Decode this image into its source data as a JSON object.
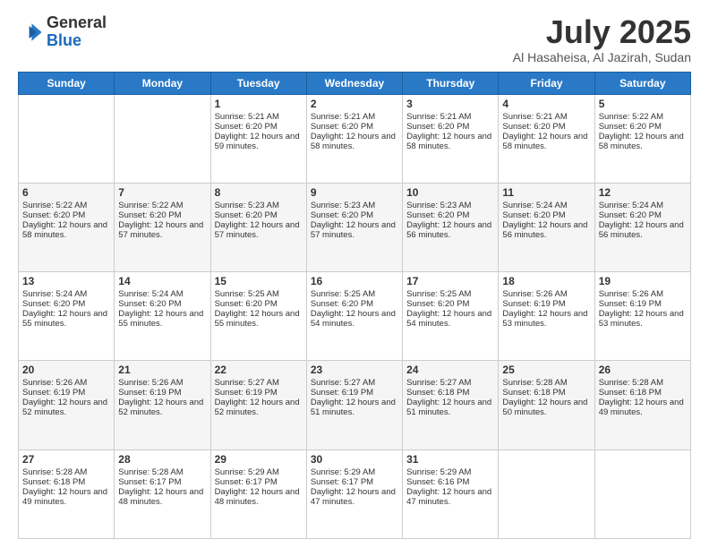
{
  "header": {
    "logo_line1": "General",
    "logo_line2": "Blue",
    "month_year": "July 2025",
    "location": "Al Hasaheisa, Al Jazirah, Sudan"
  },
  "days_of_week": [
    "Sunday",
    "Monday",
    "Tuesday",
    "Wednesday",
    "Thursday",
    "Friday",
    "Saturday"
  ],
  "weeks": [
    [
      {
        "day": "",
        "sunrise": "",
        "sunset": "",
        "daylight": ""
      },
      {
        "day": "",
        "sunrise": "",
        "sunset": "",
        "daylight": ""
      },
      {
        "day": "1",
        "sunrise": "Sunrise: 5:21 AM",
        "sunset": "Sunset: 6:20 PM",
        "daylight": "Daylight: 12 hours and 59 minutes."
      },
      {
        "day": "2",
        "sunrise": "Sunrise: 5:21 AM",
        "sunset": "Sunset: 6:20 PM",
        "daylight": "Daylight: 12 hours and 58 minutes."
      },
      {
        "day": "3",
        "sunrise": "Sunrise: 5:21 AM",
        "sunset": "Sunset: 6:20 PM",
        "daylight": "Daylight: 12 hours and 58 minutes."
      },
      {
        "day": "4",
        "sunrise": "Sunrise: 5:21 AM",
        "sunset": "Sunset: 6:20 PM",
        "daylight": "Daylight: 12 hours and 58 minutes."
      },
      {
        "day": "5",
        "sunrise": "Sunrise: 5:22 AM",
        "sunset": "Sunset: 6:20 PM",
        "daylight": "Daylight: 12 hours and 58 minutes."
      }
    ],
    [
      {
        "day": "6",
        "sunrise": "Sunrise: 5:22 AM",
        "sunset": "Sunset: 6:20 PM",
        "daylight": "Daylight: 12 hours and 58 minutes."
      },
      {
        "day": "7",
        "sunrise": "Sunrise: 5:22 AM",
        "sunset": "Sunset: 6:20 PM",
        "daylight": "Daylight: 12 hours and 57 minutes."
      },
      {
        "day": "8",
        "sunrise": "Sunrise: 5:23 AM",
        "sunset": "Sunset: 6:20 PM",
        "daylight": "Daylight: 12 hours and 57 minutes."
      },
      {
        "day": "9",
        "sunrise": "Sunrise: 5:23 AM",
        "sunset": "Sunset: 6:20 PM",
        "daylight": "Daylight: 12 hours and 57 minutes."
      },
      {
        "day": "10",
        "sunrise": "Sunrise: 5:23 AM",
        "sunset": "Sunset: 6:20 PM",
        "daylight": "Daylight: 12 hours and 56 minutes."
      },
      {
        "day": "11",
        "sunrise": "Sunrise: 5:24 AM",
        "sunset": "Sunset: 6:20 PM",
        "daylight": "Daylight: 12 hours and 56 minutes."
      },
      {
        "day": "12",
        "sunrise": "Sunrise: 5:24 AM",
        "sunset": "Sunset: 6:20 PM",
        "daylight": "Daylight: 12 hours and 56 minutes."
      }
    ],
    [
      {
        "day": "13",
        "sunrise": "Sunrise: 5:24 AM",
        "sunset": "Sunset: 6:20 PM",
        "daylight": "Daylight: 12 hours and 55 minutes."
      },
      {
        "day": "14",
        "sunrise": "Sunrise: 5:24 AM",
        "sunset": "Sunset: 6:20 PM",
        "daylight": "Daylight: 12 hours and 55 minutes."
      },
      {
        "day": "15",
        "sunrise": "Sunrise: 5:25 AM",
        "sunset": "Sunset: 6:20 PM",
        "daylight": "Daylight: 12 hours and 55 minutes."
      },
      {
        "day": "16",
        "sunrise": "Sunrise: 5:25 AM",
        "sunset": "Sunset: 6:20 PM",
        "daylight": "Daylight: 12 hours and 54 minutes."
      },
      {
        "day": "17",
        "sunrise": "Sunrise: 5:25 AM",
        "sunset": "Sunset: 6:20 PM",
        "daylight": "Daylight: 12 hours and 54 minutes."
      },
      {
        "day": "18",
        "sunrise": "Sunrise: 5:26 AM",
        "sunset": "Sunset: 6:19 PM",
        "daylight": "Daylight: 12 hours and 53 minutes."
      },
      {
        "day": "19",
        "sunrise": "Sunrise: 5:26 AM",
        "sunset": "Sunset: 6:19 PM",
        "daylight": "Daylight: 12 hours and 53 minutes."
      }
    ],
    [
      {
        "day": "20",
        "sunrise": "Sunrise: 5:26 AM",
        "sunset": "Sunset: 6:19 PM",
        "daylight": "Daylight: 12 hours and 52 minutes."
      },
      {
        "day": "21",
        "sunrise": "Sunrise: 5:26 AM",
        "sunset": "Sunset: 6:19 PM",
        "daylight": "Daylight: 12 hours and 52 minutes."
      },
      {
        "day": "22",
        "sunrise": "Sunrise: 5:27 AM",
        "sunset": "Sunset: 6:19 PM",
        "daylight": "Daylight: 12 hours and 52 minutes."
      },
      {
        "day": "23",
        "sunrise": "Sunrise: 5:27 AM",
        "sunset": "Sunset: 6:19 PM",
        "daylight": "Daylight: 12 hours and 51 minutes."
      },
      {
        "day": "24",
        "sunrise": "Sunrise: 5:27 AM",
        "sunset": "Sunset: 6:18 PM",
        "daylight": "Daylight: 12 hours and 51 minutes."
      },
      {
        "day": "25",
        "sunrise": "Sunrise: 5:28 AM",
        "sunset": "Sunset: 6:18 PM",
        "daylight": "Daylight: 12 hours and 50 minutes."
      },
      {
        "day": "26",
        "sunrise": "Sunrise: 5:28 AM",
        "sunset": "Sunset: 6:18 PM",
        "daylight": "Daylight: 12 hours and 49 minutes."
      }
    ],
    [
      {
        "day": "27",
        "sunrise": "Sunrise: 5:28 AM",
        "sunset": "Sunset: 6:18 PM",
        "daylight": "Daylight: 12 hours and 49 minutes."
      },
      {
        "day": "28",
        "sunrise": "Sunrise: 5:28 AM",
        "sunset": "Sunset: 6:17 PM",
        "daylight": "Daylight: 12 hours and 48 minutes."
      },
      {
        "day": "29",
        "sunrise": "Sunrise: 5:29 AM",
        "sunset": "Sunset: 6:17 PM",
        "daylight": "Daylight: 12 hours and 48 minutes."
      },
      {
        "day": "30",
        "sunrise": "Sunrise: 5:29 AM",
        "sunset": "Sunset: 6:17 PM",
        "daylight": "Daylight: 12 hours and 47 minutes."
      },
      {
        "day": "31",
        "sunrise": "Sunrise: 5:29 AM",
        "sunset": "Sunset: 6:16 PM",
        "daylight": "Daylight: 12 hours and 47 minutes."
      },
      {
        "day": "",
        "sunrise": "",
        "sunset": "",
        "daylight": ""
      },
      {
        "day": "",
        "sunrise": "",
        "sunset": "",
        "daylight": ""
      }
    ]
  ]
}
